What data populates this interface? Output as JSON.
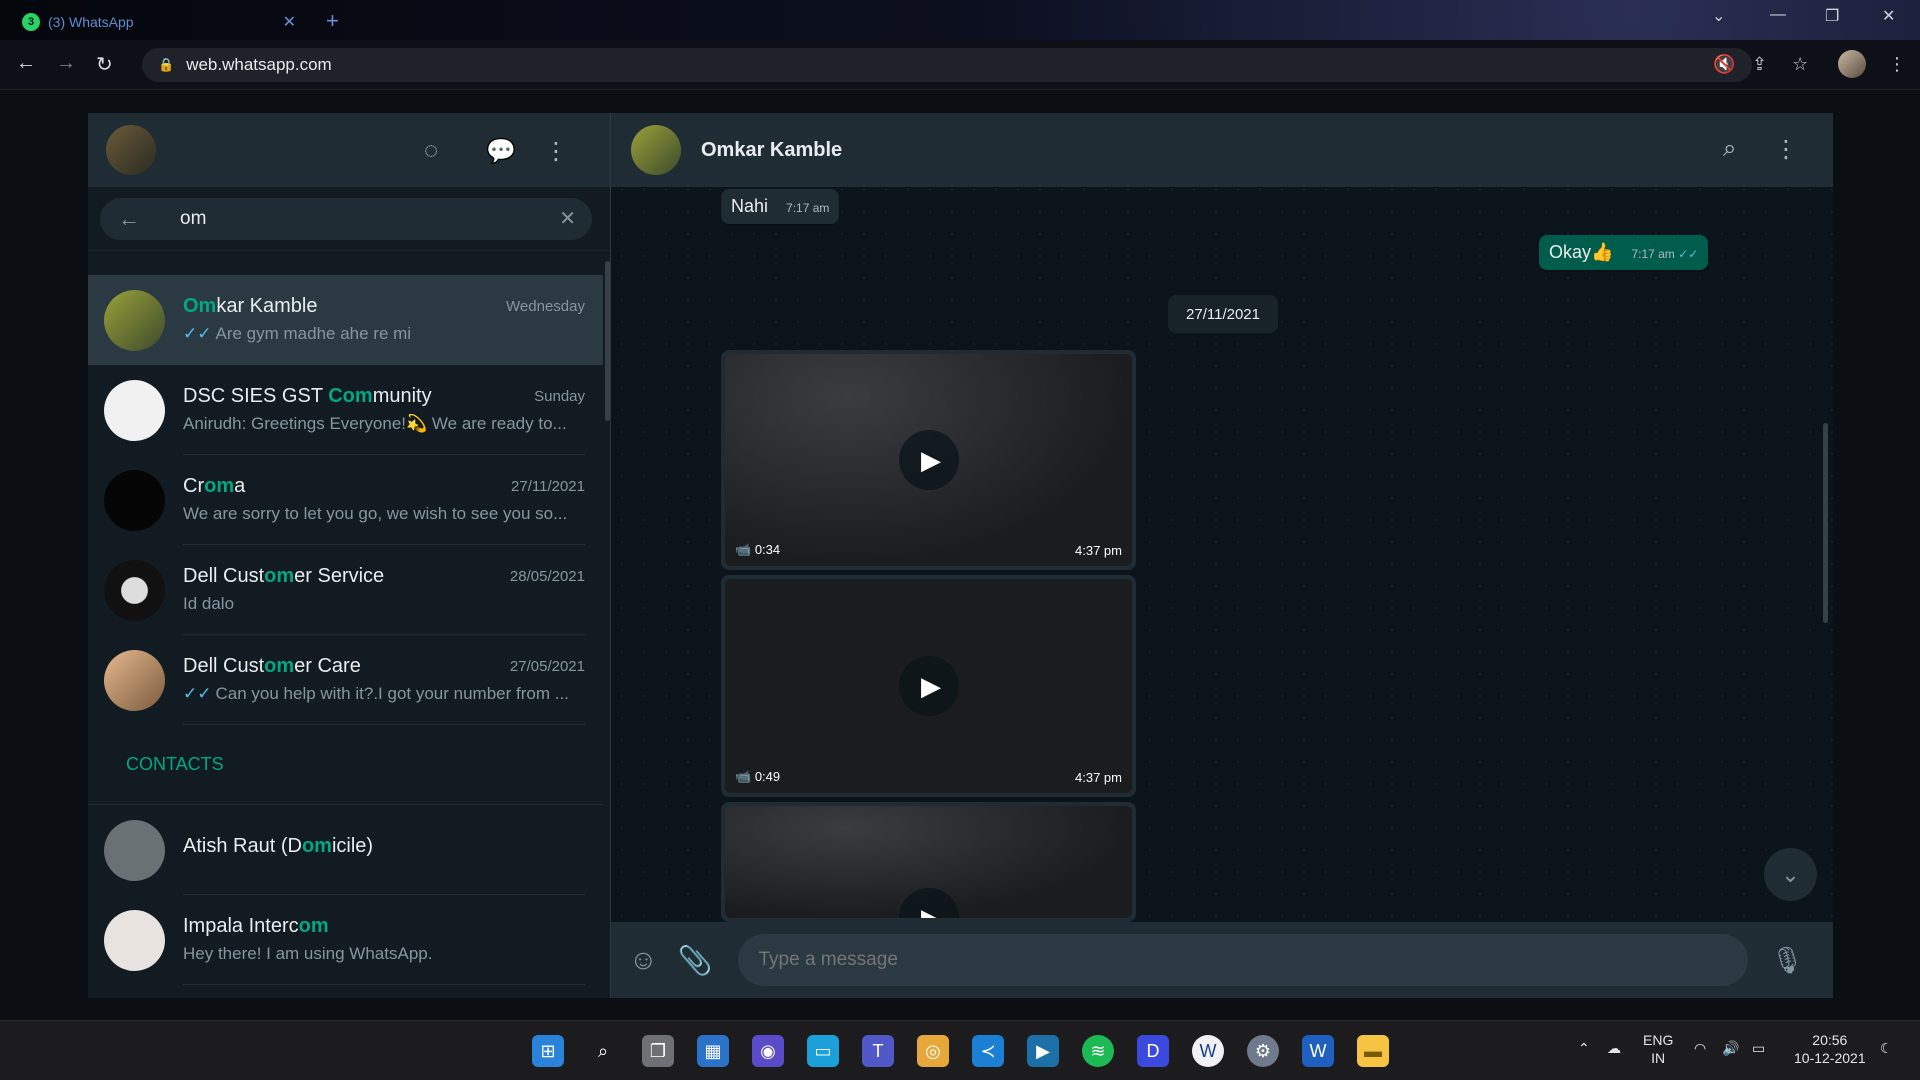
{
  "browser": {
    "tab_title": "(3) WhatsApp",
    "tab_badge": "3",
    "url": "web.whatsapp.com"
  },
  "sidebar": {
    "search_query": "om",
    "chats": [
      {
        "name_hl": "Om",
        "name_rest": "kar Kamble",
        "name_pre": "",
        "time": "Wednesday",
        "ticks": true,
        "preview": "Are gym madhe ahe re mi",
        "active": true
      },
      {
        "name_pre": "DSC SIES GST ",
        "name_hl": "Com",
        "name_rest": "munity",
        "time": "Sunday",
        "ticks": false,
        "preview": "Anirudh: Greetings Everyone!💫 We are ready to..."
      },
      {
        "name_pre": "Cr",
        "name_hl": "om",
        "name_rest": "a",
        "time": "27/11/2021",
        "ticks": false,
        "preview": "We are sorry to let you go, we wish to see you so..."
      },
      {
        "name_pre": "Dell Cust",
        "name_hl": "om",
        "name_rest": "er Service",
        "time": "28/05/2021",
        "ticks": false,
        "preview": "Id dalo"
      },
      {
        "name_pre": "Dell Cust",
        "name_hl": "om",
        "name_rest": "er Care",
        "time": "27/05/2021",
        "ticks": true,
        "preview": "Can you help with it?.I got your number from ..."
      }
    ],
    "contacts_label": "CONTACTS",
    "contacts": [
      {
        "name_pre": "Atish Raut (D",
        "name_hl": "om",
        "name_rest": "icile)",
        "preview": ""
      },
      {
        "name_pre": "Impala Interc",
        "name_hl": "om",
        "name_rest": "",
        "preview": "Hey there! I am using WhatsApp."
      }
    ]
  },
  "chat": {
    "contact_name": "Omkar Kamble",
    "messages": {
      "in_text": "Nahi",
      "in_time": "7:17 am",
      "out_text": "Okay👍",
      "out_time": "7:17 am"
    },
    "date_pill": "27/11/2021",
    "videos": [
      {
        "duration": "0:34",
        "time": "4:37 pm"
      },
      {
        "duration": "0:49",
        "time": "4:37 pm"
      }
    ],
    "composer_placeholder": "Type a message"
  },
  "taskbar": {
    "lang_top": "ENG",
    "lang_bottom": "IN",
    "clock_time": "20:56",
    "clock_date": "10-12-2021"
  },
  "colors": {
    "accent": "#00a884",
    "outgoing": "#005c4b",
    "panel": "#202c33",
    "background": "#111b21"
  }
}
